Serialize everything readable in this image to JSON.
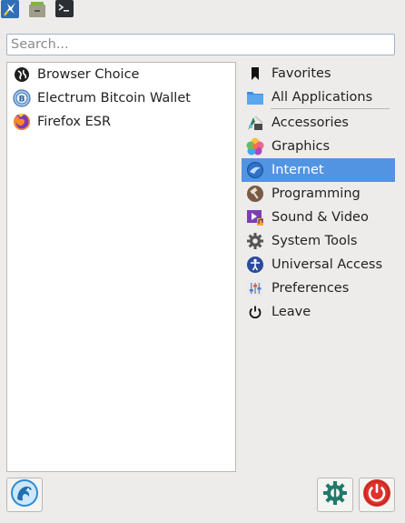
{
  "top_launchers": [
    {
      "name": "kali-launcher-icon"
    },
    {
      "name": "file-manager-icon"
    },
    {
      "name": "terminal-icon"
    }
  ],
  "search": {
    "placeholder": "Search..."
  },
  "apps": [
    {
      "label": "Browser Choice",
      "icon": "browser-choice-icon"
    },
    {
      "label": "Electrum Bitcoin Wallet",
      "icon": "electrum-icon"
    },
    {
      "label": "Firefox ESR",
      "icon": "firefox-icon"
    }
  ],
  "categories": [
    {
      "label": "Favorites",
      "icon": "bookmark-icon"
    },
    {
      "label": "All Applications",
      "icon": "folder-icon"
    },
    {
      "label": "Accessories",
      "icon": "accessories-icon"
    },
    {
      "label": "Graphics",
      "icon": "graphics-icon"
    },
    {
      "label": "Internet",
      "icon": "internet-icon",
      "active": true
    },
    {
      "label": "Programming",
      "icon": "hammer-icon"
    },
    {
      "label": "Sound & Video",
      "icon": "multimedia-icon"
    },
    {
      "label": "System Tools",
      "icon": "gear-icon"
    },
    {
      "label": "Universal Access",
      "icon": "accessibility-icon"
    },
    {
      "label": "Preferences",
      "icon": "preferences-icon"
    },
    {
      "label": "Leave",
      "icon": "power-icon"
    }
  ],
  "colors": {
    "accent": "#5294e2",
    "background": "#edeceb",
    "power_red": "#e0322a",
    "settings_teal": "#1f7a6b"
  }
}
